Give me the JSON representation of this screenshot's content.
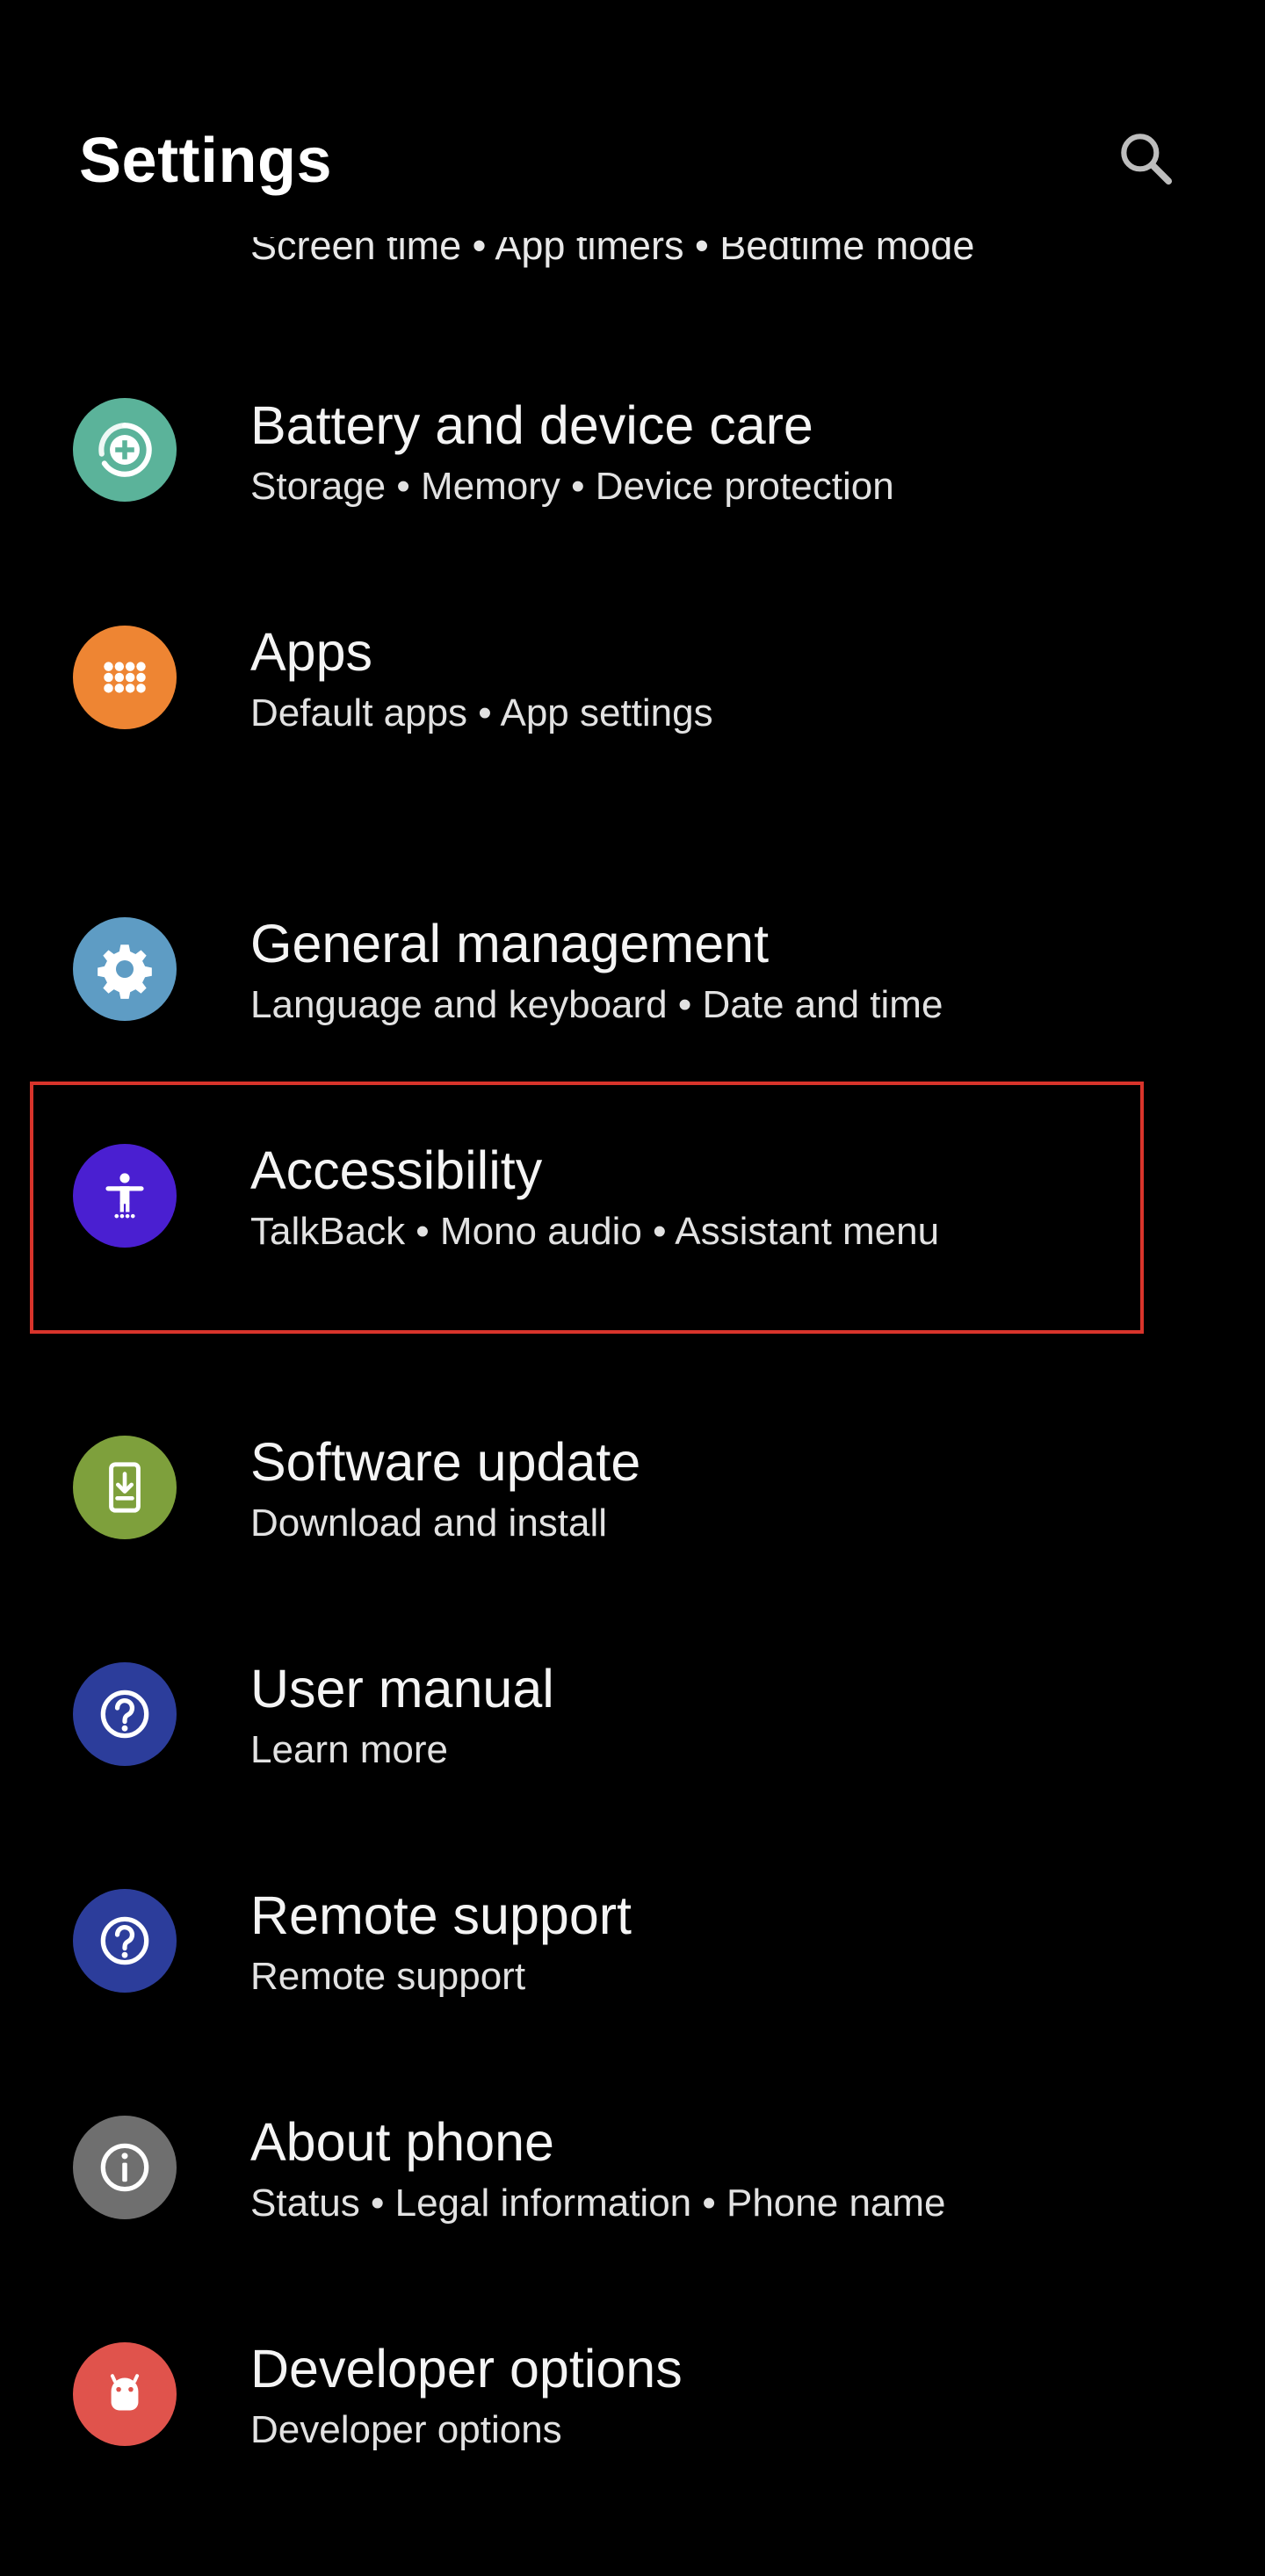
{
  "header": {
    "title": "Settings",
    "search_icon": "search-icon"
  },
  "partial_item": {
    "subtitle": "Screen time  •  App timers  •  Bedtime mode"
  },
  "items": [
    {
      "title": "Battery and device care",
      "subtitle": "Storage  •  Memory  •  Device protection",
      "icon": "battery-care-icon",
      "color": "#5bb39a"
    },
    {
      "title": "Apps",
      "subtitle": "Default apps  •  App settings",
      "icon": "apps-grid-icon",
      "color": "#ee8533"
    },
    {
      "title": "General management",
      "subtitle": "Language and keyboard  •  Date and time",
      "icon": "gear-icon",
      "color": "#5e9cc4"
    },
    {
      "title": "Accessibility",
      "subtitle": "TalkBack  •  Mono audio  •  Assistant menu",
      "icon": "accessibility-icon",
      "color": "#4a1fd1"
    },
    {
      "title": "Software update",
      "subtitle": "Download and install",
      "icon": "software-update-icon",
      "color": "#7ea03c"
    },
    {
      "title": "User manual",
      "subtitle": "Learn more",
      "icon": "question-icon",
      "color": "#2c3d9b"
    },
    {
      "title": "Remote support",
      "subtitle": "Remote support",
      "icon": "question-icon",
      "color": "#2c3d9b"
    },
    {
      "title": "About phone",
      "subtitle": "Status  •  Legal information  •  Phone name",
      "icon": "info-icon",
      "color": "#6f6f6f"
    },
    {
      "title": "Developer options",
      "subtitle": "Developer options",
      "icon": "android-icon",
      "color": "#e0534c"
    }
  ],
  "highlight": {
    "color": "#d8342b",
    "target": "Accessibility"
  }
}
